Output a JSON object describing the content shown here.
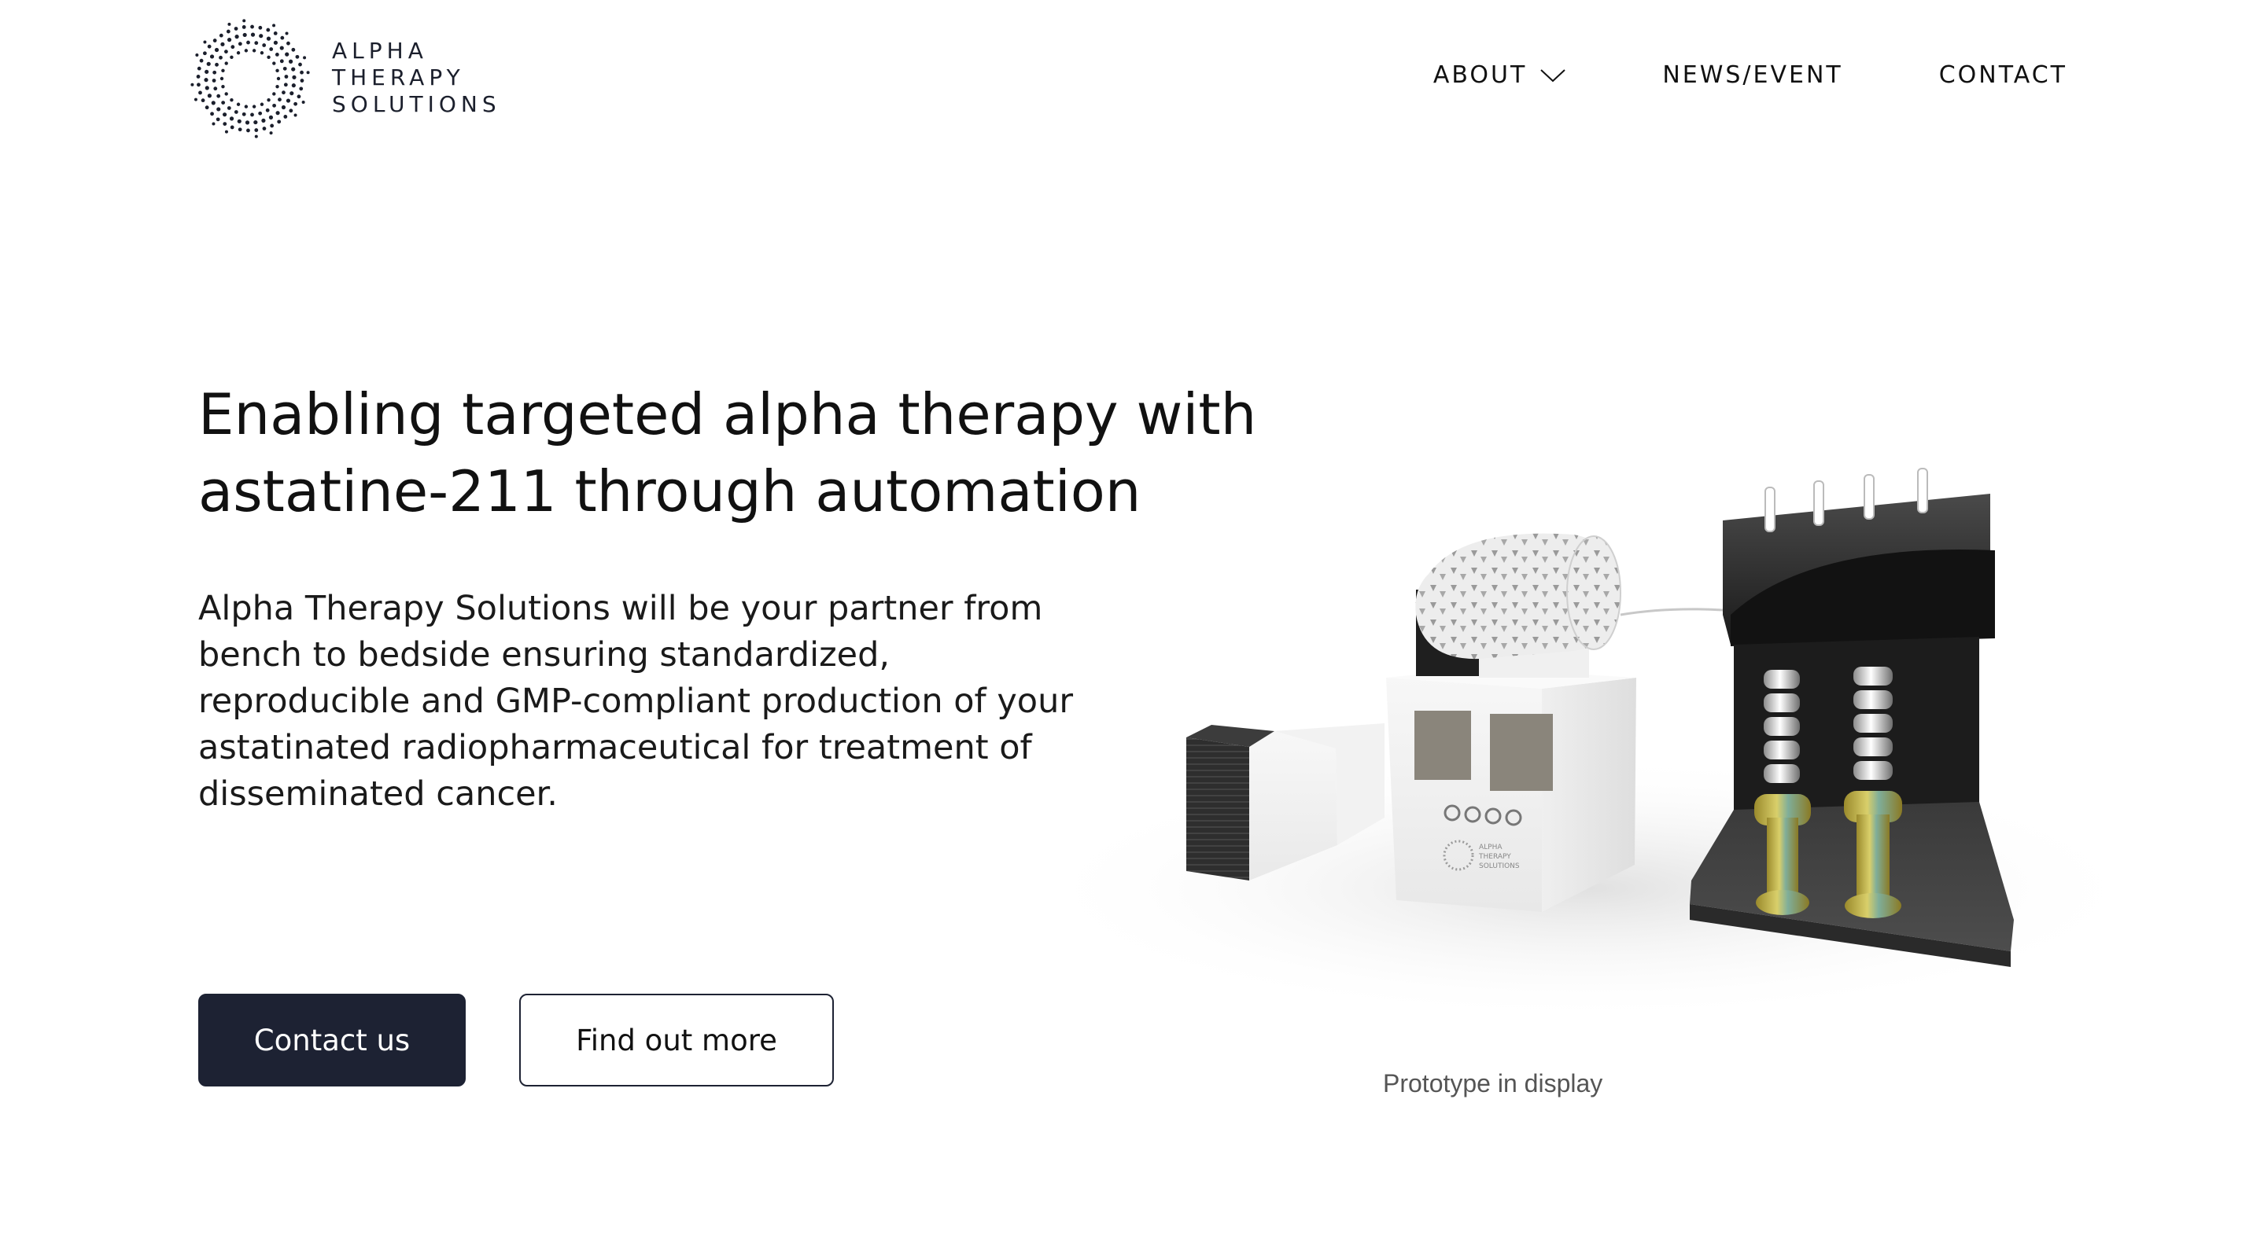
{
  "brand": {
    "line1": "ALPHA",
    "line2": "THERAPY",
    "line3": "SOLUTIONS",
    "logo_icon": "dotted-ring-logo-icon"
  },
  "nav": {
    "about": "ABOUT",
    "about_icon": "chevron-down-icon",
    "news": "NEWS/EVENT",
    "contact": "CONTACT"
  },
  "hero": {
    "title_line1": "Enabling targeted alpha therapy with",
    "title_line2": "astatine-211 through automation",
    "body_lines": [
      "Alpha Therapy Solutions will be your partner from",
      "bench to bedside ensuring standardized,",
      "reproducible and GMP-compliant production of your",
      "astatinated radiopharmaceutical for treatment of",
      "disseminated cancer."
    ],
    "primary_button": "Contact us",
    "secondary_button": "Find out more"
  },
  "image": {
    "caption": "Prototype in display",
    "device_label_lines": [
      "ALPHA",
      "THERAPY",
      "SOLUTIONS"
    ]
  },
  "colors": {
    "primary_button_bg": "#1d2233",
    "text": "#111111",
    "caption": "#555555"
  }
}
